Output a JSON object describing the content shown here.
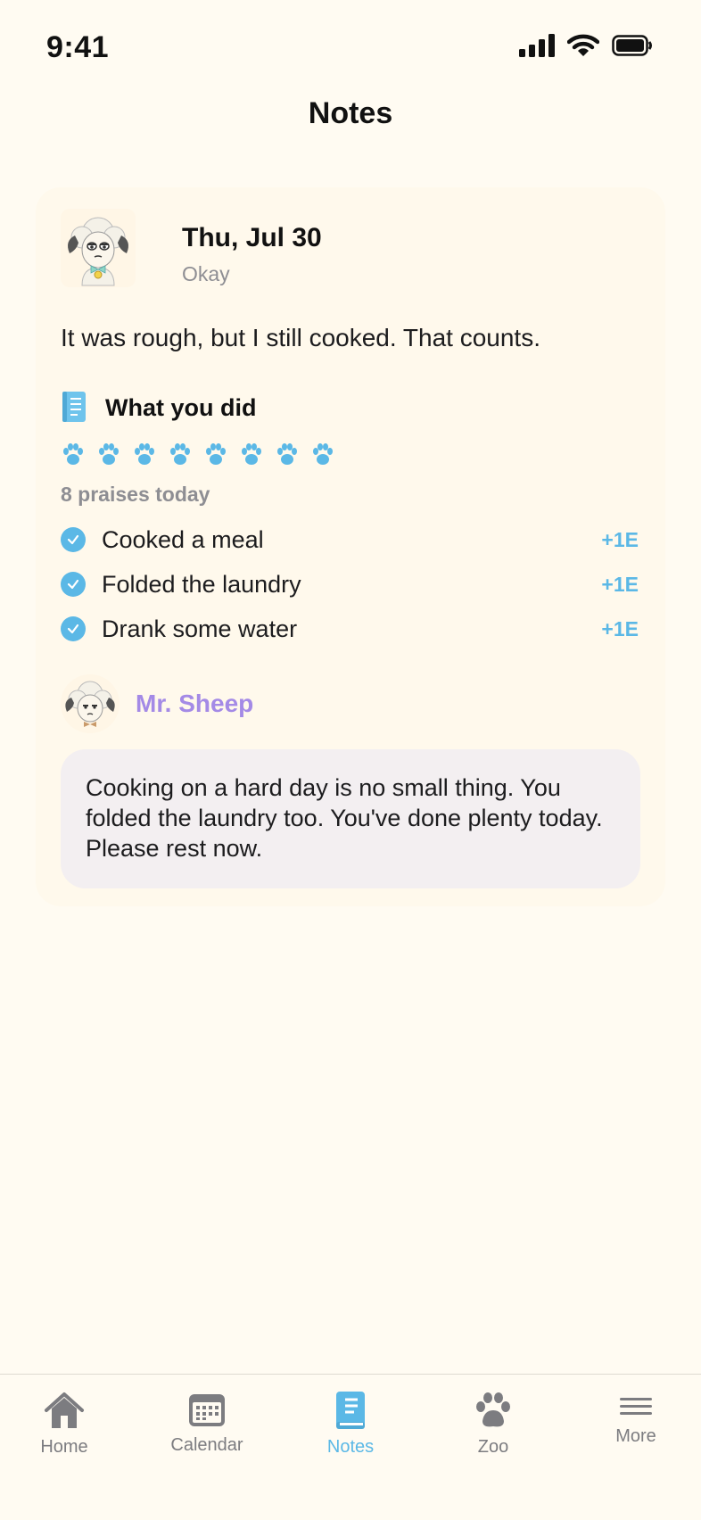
{
  "status_bar": {
    "time": "9:41"
  },
  "nav": {
    "title": "Notes"
  },
  "entry": {
    "date": "Thu, Jul 30",
    "mood": "Okay",
    "text": "It was rough, but I still cooked. That counts.",
    "section_title": "What you did",
    "paw_count": 8,
    "praises_text": "8 praises today",
    "tasks": [
      {
        "label": "Cooked a meal",
        "points": "+1E"
      },
      {
        "label": "Folded the laundry",
        "points": "+1E"
      },
      {
        "label": "Drank some water",
        "points": "+1E"
      }
    ]
  },
  "reply": {
    "author": "Mr. Sheep",
    "message": "Cooking on a hard day is no small thing. You folded the laundry too. You've done plenty today. Please rest now."
  },
  "tab_bar": {
    "items": [
      {
        "label": "Home",
        "icon": "home-icon",
        "active": false
      },
      {
        "label": "Calendar",
        "icon": "calendar-icon",
        "active": false
      },
      {
        "label": "Notes",
        "icon": "book-icon",
        "active": true
      },
      {
        "label": "Zoo",
        "icon": "paw-icon",
        "active": false
      },
      {
        "label": "More",
        "icon": "menu-icon",
        "active": false
      }
    ]
  },
  "colors": {
    "accent": "#5BB8E6",
    "sheep_name": "#A48AE6",
    "background": "#FFFBF2"
  }
}
